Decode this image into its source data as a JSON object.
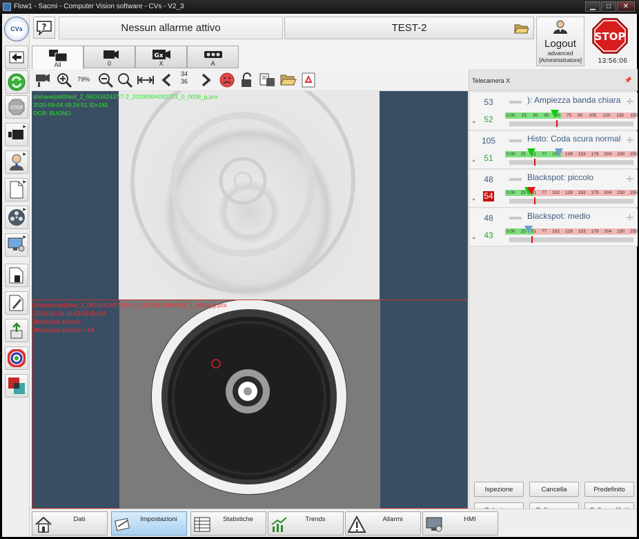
{
  "window": {
    "title": "Flow1 - Sacmi - Computer Vision software - CVs - V2_3",
    "controls": [
      "▁",
      "□",
      "✕"
    ]
  },
  "header": {
    "logo_text": "CVs",
    "help_label": "?",
    "alarm_status": "Nessun allarme attivo",
    "recipe_name": "TEST-2",
    "logout_label": "Logout",
    "user_level": "advanced",
    "user_role": "[Amministratore]",
    "stop_label": "STOP",
    "clock": "13:56:06"
  },
  "camera_tabs": [
    {
      "label": "All",
      "icon": "multi-camera-icon",
      "active": true
    },
    {
      "label": "0",
      "icon": "camera-icon",
      "active": false
    },
    {
      "label": "X",
      "icon": "camera-gx-icon",
      "active": false
    },
    {
      "label": "A",
      "icon": "camera-ooo-icon",
      "active": false
    }
  ],
  "image_toolbar": {
    "zoom": "79%",
    "frame_current": "34",
    "frame_total": "36",
    "icons": [
      "camera-settings-icon",
      "zoom-in-icon",
      "zoom-out-icon",
      "zoom-fit-icon",
      "fit-width-icon",
      "previous-icon",
      "next-icon",
      "sad-face-icon",
      "unlock-icon",
      "transfer-icon",
      "open-folder-icon",
      "recycle-icon"
    ]
  },
  "views": [
    {
      "path": "d/share/job0/test_2_0616162437/7-2_20200904092723_0_0008_g.pcs",
      "datetime": "2020-09-04 09:24:51 ID=181",
      "result": "OCR: BUONO",
      "color": "#2ee62e"
    },
    {
      "path": "d/share/job1/test_2_0616162437/144_1_20200619164303_1_0034_g.pcs",
      "datetime": "2020-06-19 16:43:03 ID=34",
      "result": "Blackspot: piccolo",
      "detail": "Blackspot: piccolo > 54",
      "color": "#ff2a2a"
    }
  ],
  "right_panel": {
    "title": "Telecamera X",
    "pin": "📌",
    "controls": [
      {
        "value_top": "53",
        "value_bottom": "52",
        "bottom_bad": false,
        "name": "): Ampiezza banda chiara",
        "scale": [
          "0.00",
          "15",
          "30",
          "45",
          "60",
          "75",
          "90",
          "105",
          "120",
          "135",
          "150"
        ],
        "green_fraction": 0.43,
        "marker": 0.38,
        "marker_color": "green",
        "position": 0.38
      },
      {
        "value_top": "105",
        "value_bottom": "51",
        "bottom_bad": false,
        "name": "Histo: Coda scura normal",
        "scale": [
          "0.00",
          "25",
          "51",
          "77",
          "102",
          "128",
          "153",
          "179",
          "204",
          "230",
          "255"
        ],
        "green_fraction": 0.43,
        "marker": 0.41,
        "marker_color": "blue",
        "marker2": 0.2,
        "position": 0.2
      },
      {
        "value_top": "48",
        "value_bottom": "54",
        "bottom_bad": true,
        "name": "Blackspot: piccolo",
        "scale": [
          "0.00",
          "25",
          "51",
          "77",
          "102",
          "128",
          "153",
          "179",
          "204",
          "230",
          "255"
        ],
        "green_fraction": 0.22,
        "marker": 0.2,
        "marker_color": "red",
        "marker2": 0.18,
        "position": 0.2
      },
      {
        "value_top": "48",
        "value_bottom": "43",
        "bottom_bad": false,
        "name": "Blackspot: medio",
        "scale": [
          "0.00",
          "25",
          "51",
          "77",
          "102",
          "128",
          "153",
          "179",
          "204",
          "230",
          "255"
        ],
        "green_fraction": 0.22,
        "marker": 0.18,
        "marker_color": "blue",
        "position": 0.18
      }
    ],
    "buttons": {
      "ispezione": "Ispezione",
      "cancella": "Cancella",
      "predefinito": "Predefinito",
      "seleziona": "Seleziona",
      "collega_aree": "Collega aree",
      "collega_difetti": "Collega difetti"
    }
  },
  "bottom_nav": [
    {
      "label": "Dati",
      "icon": "home-icon",
      "active": false
    },
    {
      "label": "Impostazioni",
      "icon": "settings-icon",
      "active": true
    },
    {
      "label": "Statistiche",
      "icon": "statistics-icon",
      "active": false
    },
    {
      "label": "Trends",
      "icon": "trends-icon",
      "active": false
    },
    {
      "label": "Allarmi",
      "icon": "alarm-icon",
      "active": false
    },
    {
      "label": "HMI",
      "icon": "hmi-icon",
      "active": false
    }
  ]
}
